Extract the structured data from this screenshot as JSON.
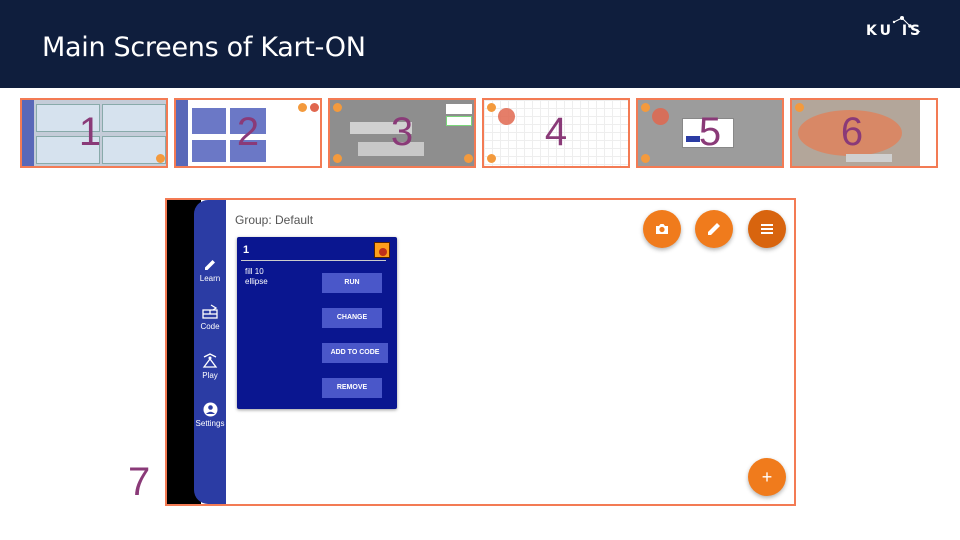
{
  "header": {
    "title": "Main Screens of Kart-ON",
    "logo_text": "KU IS"
  },
  "thumbnails": [
    {
      "number": "1"
    },
    {
      "number": "2"
    },
    {
      "number": "3"
    },
    {
      "number": "4"
    },
    {
      "number": "5"
    },
    {
      "number": "6"
    }
  ],
  "main_label": "7",
  "app": {
    "group_label": "Group: Default",
    "nav": [
      {
        "label": "Learn",
        "icon": "pencil-icon"
      },
      {
        "label": "Code",
        "icon": "code-icon"
      },
      {
        "label": "Play",
        "icon": "play-icon"
      },
      {
        "label": "Settings",
        "icon": "settings-icon"
      }
    ],
    "card": {
      "title": "1",
      "code": "fill 10\nellipse",
      "run_label": "RUN",
      "change_label": "CHANGE",
      "add_label": "ADD TO CODE",
      "remove_label": "REMOVE"
    },
    "fab_add_label": "+"
  },
  "colors": {
    "header_bg": "#0f1e3d",
    "accent": "#f07b1c",
    "sidebar": "#2b3ca4",
    "card": "#0a1690",
    "border": "#f37b54",
    "label": "#8a3a78"
  }
}
